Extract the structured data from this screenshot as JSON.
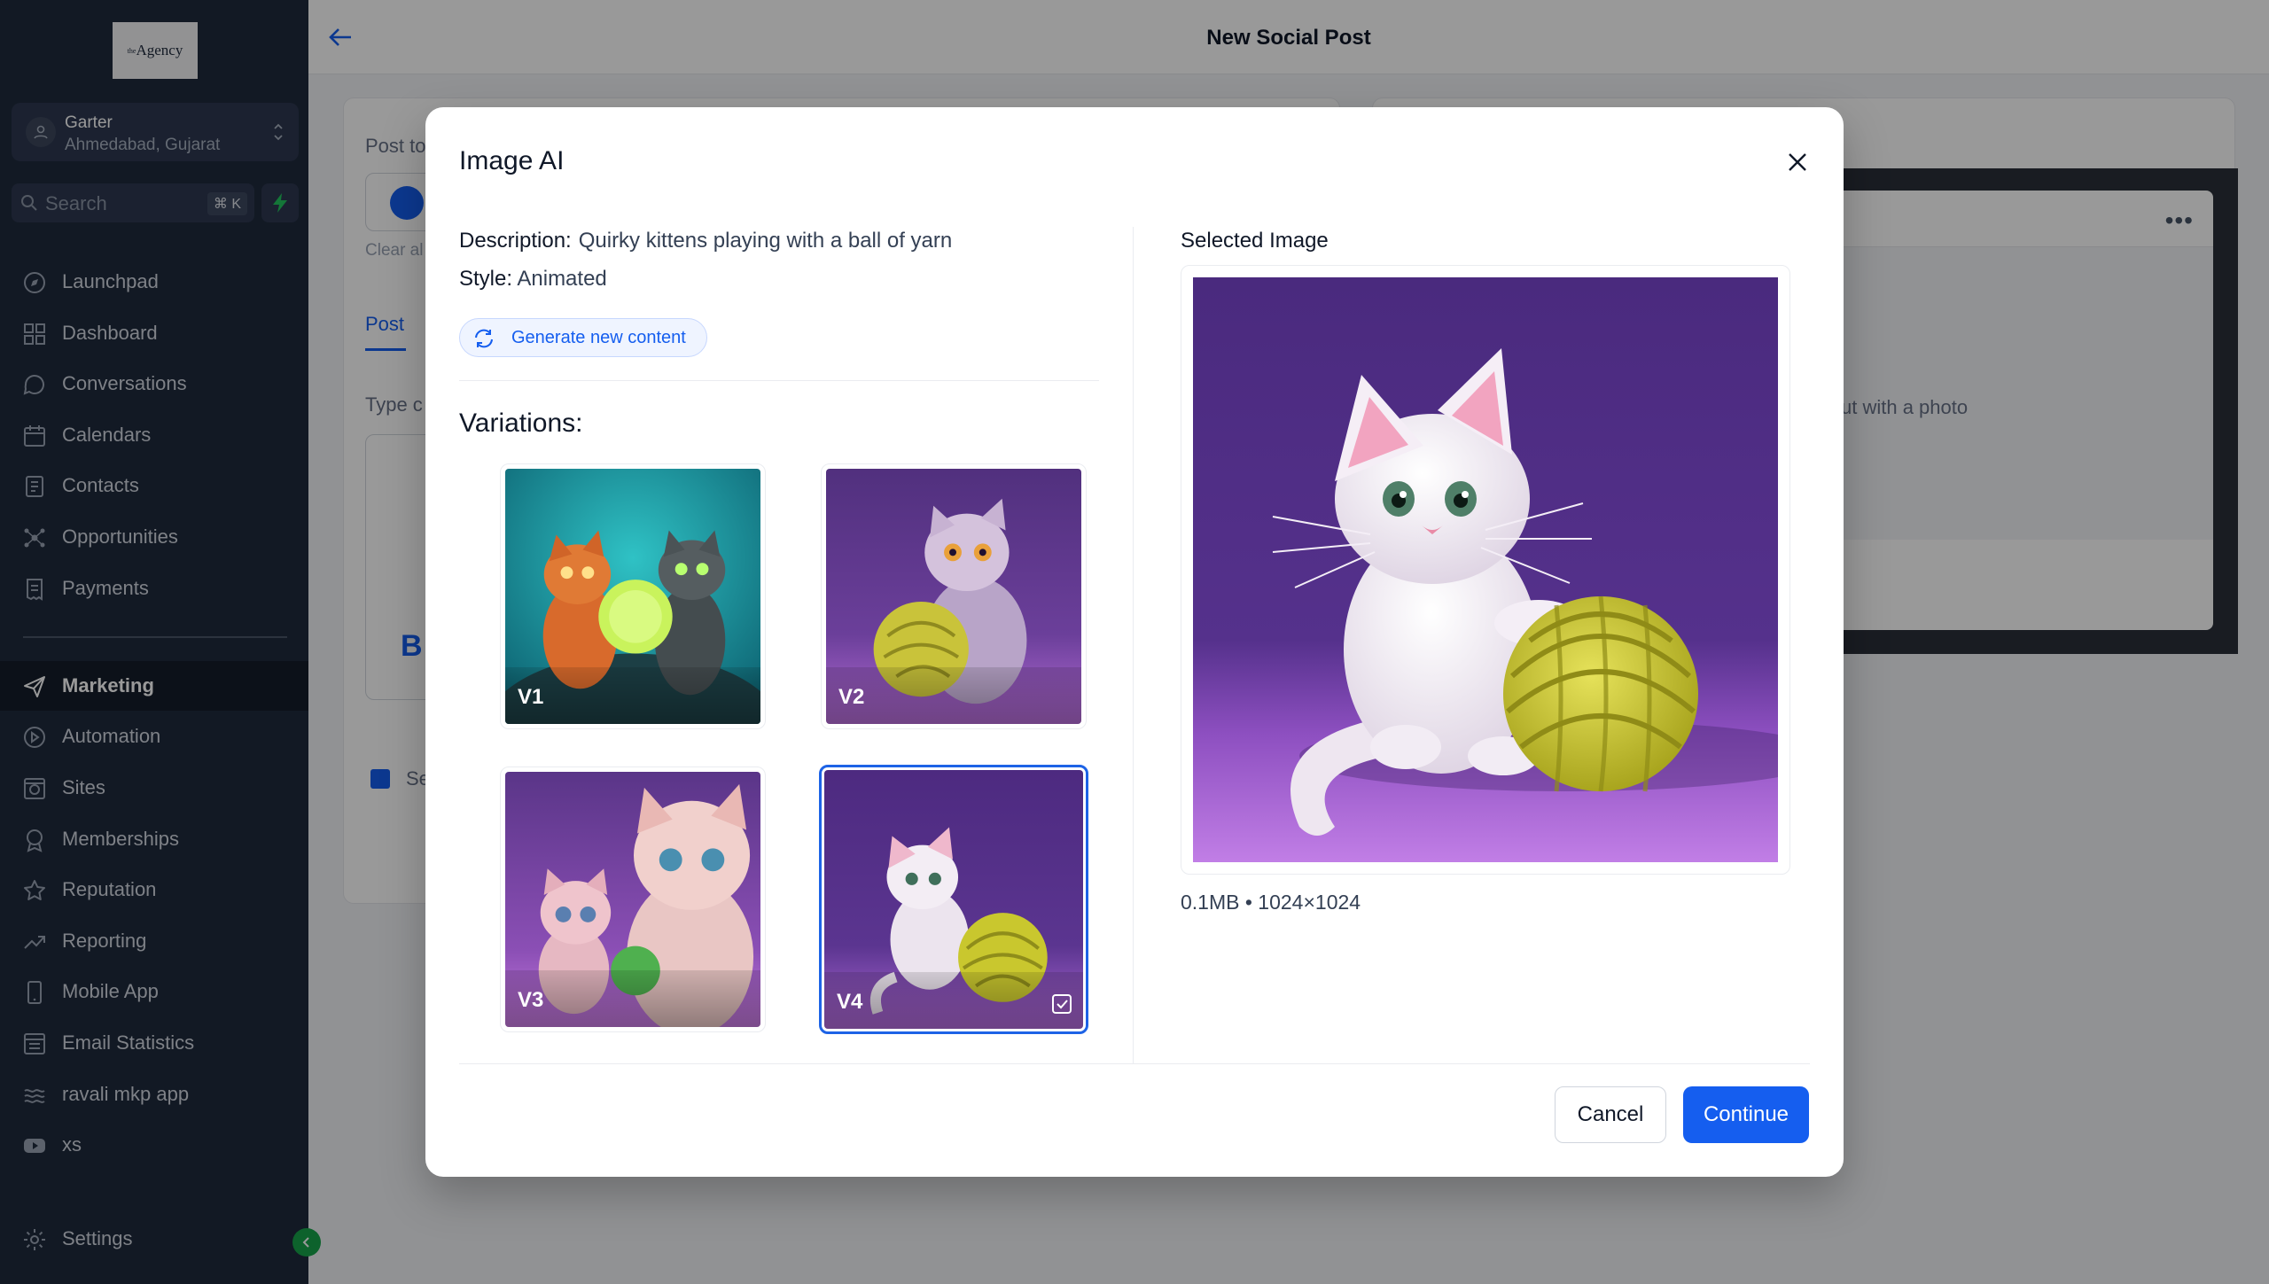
{
  "sidebar": {
    "logo_text": "Agency",
    "logo_sup": "the",
    "account_name": "Garter",
    "account_location": "Ahmedabad, Gujarat",
    "search_placeholder": "Search",
    "search_shortcut": "⌘ K",
    "items": [
      {
        "label": "Launchpad",
        "icon": "rocket-icon"
      },
      {
        "label": "Dashboard",
        "icon": "grid-icon"
      },
      {
        "label": "Conversations",
        "icon": "chat-icon"
      },
      {
        "label": "Calendars",
        "icon": "calendar-icon"
      },
      {
        "label": "Contacts",
        "icon": "contacts-icon"
      },
      {
        "label": "Opportunities",
        "icon": "network-icon"
      },
      {
        "label": "Payments",
        "icon": "receipt-icon"
      },
      {
        "label": "Marketing",
        "icon": "send-icon"
      },
      {
        "label": "Automation",
        "icon": "play-icon"
      },
      {
        "label": "Sites",
        "icon": "globe-icon"
      },
      {
        "label": "Memberships",
        "icon": "badge-icon"
      },
      {
        "label": "Reputation",
        "icon": "star-icon"
      },
      {
        "label": "Reporting",
        "icon": "trend-icon"
      },
      {
        "label": "Mobile App",
        "icon": "phone-icon"
      },
      {
        "label": "Email Statistics",
        "icon": "stats-icon"
      },
      {
        "label": "ravali mkp app",
        "icon": "layers-icon"
      },
      {
        "label": "xs",
        "icon": "youtube-icon"
      }
    ],
    "settings_label": "Settings",
    "active_item": "Marketing"
  },
  "header": {
    "title": "New Social Post"
  },
  "background": {
    "post_to": "Post to",
    "clear_all": "Clear al",
    "tab_post": "Post",
    "type_content": "Type c",
    "bold_button": "B",
    "se_label": "Se",
    "preview_hint": "ut with a photo"
  },
  "modal": {
    "title": "Image AI",
    "description_label": "Description:",
    "description_value": "Quirky kittens playing with a ball of yarn",
    "style_label": "Style:",
    "style_value": "Animated",
    "generate_label": "Generate new content",
    "variations_title": "Variations:",
    "variations": [
      {
        "label": "V1",
        "selected": false
      },
      {
        "label": "V2",
        "selected": false
      },
      {
        "label": "V3",
        "selected": false
      },
      {
        "label": "V4",
        "selected": true
      }
    ],
    "selected_title": "Selected Image",
    "selected_meta": "0.1MB • 1024×1024",
    "cancel_label": "Cancel",
    "continue_label": "Continue"
  },
  "colors": {
    "sidebar_bg": "#1f2a3c",
    "primary": "#155eef",
    "accent_green": "#16a34a"
  }
}
